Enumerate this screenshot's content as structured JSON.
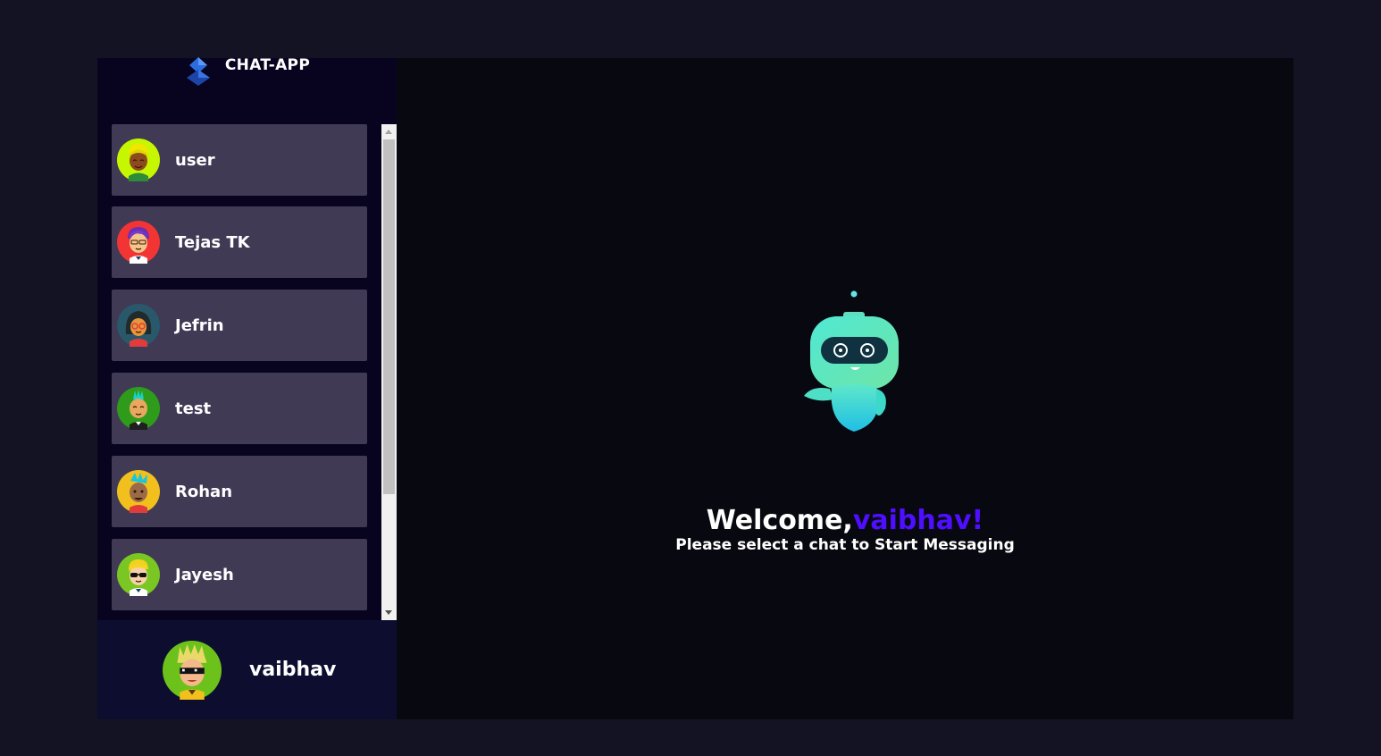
{
  "brand": {
    "title": "CHAT-APP",
    "logo_icon": "diamond-logo-icon"
  },
  "contacts": [
    {
      "name": "user",
      "avatar": "avatar-yellow-hair-icon",
      "bg": "#c6f700"
    },
    {
      "name": "Tejas TK",
      "avatar": "avatar-purple-hair-icon",
      "bg": "#f23434"
    },
    {
      "name": "Jefrin",
      "avatar": "avatar-dreadlocks-icon",
      "bg": "#29586b"
    },
    {
      "name": "test",
      "avatar": "avatar-mohawk-icon",
      "bg": "#2e9c1a"
    },
    {
      "name": "Rohan",
      "avatar": "avatar-brown-face-icon",
      "bg": "#f2c01d"
    },
    {
      "name": "Jayesh",
      "avatar": "avatar-sunglasses-icon",
      "bg": "#7ac723"
    }
  ],
  "current_user": {
    "name": "vaibhav",
    "avatar": "avatar-sunglasses-icon",
    "bg": "#6cc21a"
  },
  "welcome": {
    "greeting": "Welcome,",
    "username": "vaibhav!",
    "subtitle": "Please select a chat to Start Messaging"
  },
  "colors": {
    "accent": "#4e0eff",
    "contact_bg": "#403a55",
    "sidebar_bg": "#080420"
  }
}
